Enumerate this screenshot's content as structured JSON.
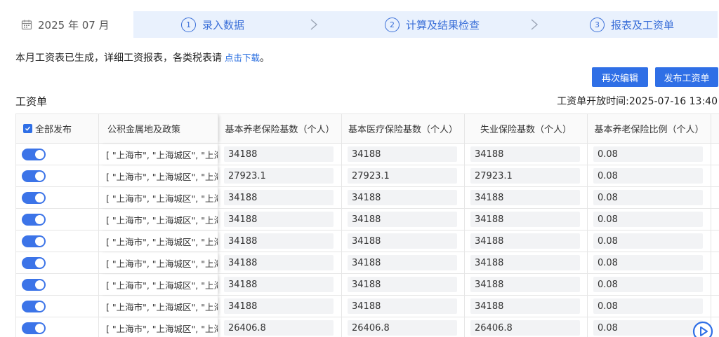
{
  "stepbar": {
    "month": "2025 年 07 月",
    "steps": [
      {
        "num": "1",
        "label": "录入数据"
      },
      {
        "num": "2",
        "label": "计算及结果检查"
      },
      {
        "num": "3",
        "label": "报表及工资单"
      }
    ]
  },
  "notice": {
    "text": "本月工资表已生成，详细工资报表，各类税表请",
    "link": "点击下载",
    "suffix": "。"
  },
  "buttons": {
    "edit": "再次编辑",
    "publish": "发布工资单"
  },
  "section_title": "工资单",
  "open_time": "工资单开放时间:2025-07-16 13:40",
  "table": {
    "headers": [
      "全部发布",
      "公积金属地及政策",
      "基本养老保险基数（个人）",
      "基本医疗保险基数（个人）",
      "失业保险基数（个人）",
      "基本养老保险比例（个人）"
    ],
    "rows": [
      {
        "policy": "[ \"上海市\", \"上海城区\", \"上海",
        "pension_base": "34188",
        "medical_base": "34188",
        "unemp_base": "34188",
        "pension_ratio": "0.08"
      },
      {
        "policy": "[ \"上海市\", \"上海城区\", \"上海",
        "pension_base": "27923.1",
        "medical_base": "27923.1",
        "unemp_base": "27923.1",
        "pension_ratio": "0.08"
      },
      {
        "policy": "[ \"上海市\", \"上海城区\", \"上海",
        "pension_base": "34188",
        "medical_base": "34188",
        "unemp_base": "34188",
        "pension_ratio": "0.08"
      },
      {
        "policy": "[ \"上海市\", \"上海城区\", \"上海",
        "pension_base": "34188",
        "medical_base": "34188",
        "unemp_base": "34188",
        "pension_ratio": "0.08"
      },
      {
        "policy": "[ \"上海市\", \"上海城区\", \"上海",
        "pension_base": "34188",
        "medical_base": "34188",
        "unemp_base": "34188",
        "pension_ratio": "0.08"
      },
      {
        "policy": "[ \"上海市\", \"上海城区\", \"上海",
        "pension_base": "34188",
        "medical_base": "34188",
        "unemp_base": "34188",
        "pension_ratio": "0.08"
      },
      {
        "policy": "[ \"上海市\", \"上海城区\", \"上海",
        "pension_base": "34188",
        "medical_base": "34188",
        "unemp_base": "34188",
        "pension_ratio": "0.08"
      },
      {
        "policy": "[ \"上海市\", \"上海城区\", \"上海",
        "pension_base": "34188",
        "medical_base": "34188",
        "unemp_base": "34188",
        "pension_ratio": "0.08"
      },
      {
        "policy": "[ \"上海市\", \"上海城区\", \"上海",
        "pension_base": "26406.8",
        "medical_base": "26406.8",
        "unemp_base": "26406.8",
        "pension_ratio": "0.08"
      }
    ]
  },
  "colors": {
    "accent": "#2f6fe6",
    "stepbar_bg": "#e9f1fd",
    "input_bg": "#f2f3f5"
  },
  "icons": [
    "calendar-icon",
    "chevron-right-icon",
    "checkbox-checked-icon",
    "toggle-on-icon",
    "play-circle-icon"
  ]
}
